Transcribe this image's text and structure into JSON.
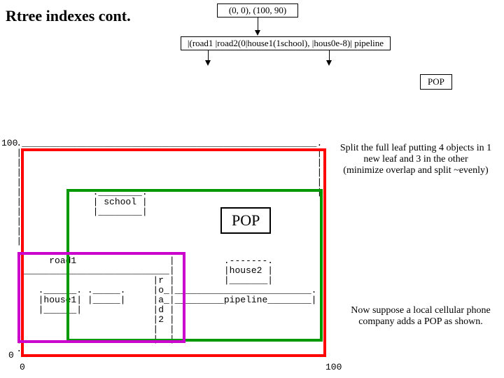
{
  "title": "Rtree indexes cont.",
  "root_label": "(0, 0),  (100, 90)",
  "leaf_label": "|(road1 |road2(0|house1(1school), |hous0e-8)| pipeline",
  "pop_label": "POP",
  "pop_big_label": "POP",
  "note1_line1": "Split the full leaf putting 4 objects in 1",
  "note1_line2": "new leaf and 3 in the other",
  "note1_line3": "(minimize overlap and split ~evenly)",
  "note2_line1": "Now suppose a local cellular phone",
  "note2_line2": "company adds a POP as shown.",
  "axis_100": "100",
  "axis_0a": "0",
  "axis_0b": "0",
  "axis_100b": "100",
  "ascii": "   .______________________________________________________.\n   |                                                      |\n   |                                                      |\n   |                                                      |\n   |                                                      |\n   |             .________.                               |\n   |             | school |                                \n   |             |________|                                \n   |                                                       \n   |                                                       \n   |                                                       \n   .___________________________.                           \n   |     road1                 |         .-------.         \n   .___________________________|         |house2 |         \n   |                        |r |         |_______|         \n   |   .______. ._____.     |o_|_________________________. \n   |   |house1| |_____|     |a_|_________pipeline________| \n   |   |______|             |d |                           \n   |                        |2 |                           \n   |                        |  |                           \n   |                        |__|                           \n   .                                                       "
}
